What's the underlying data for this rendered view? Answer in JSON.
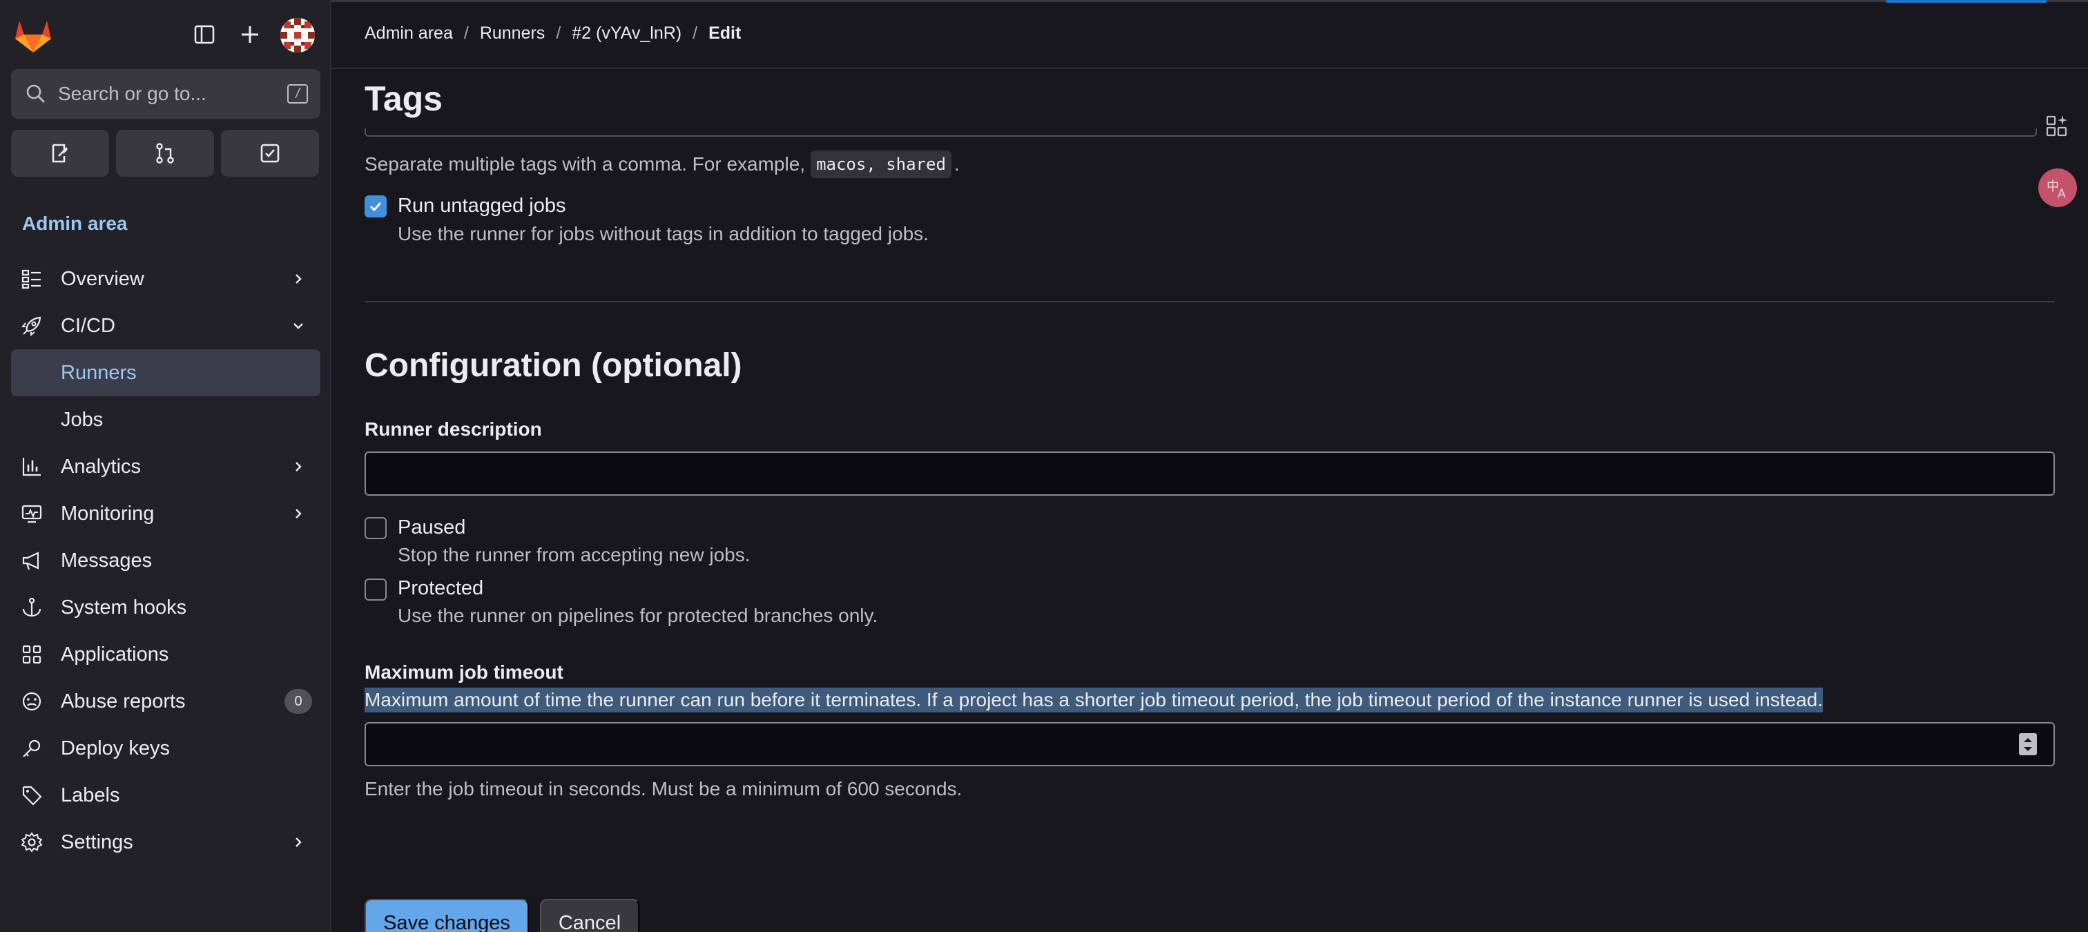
{
  "sidebar": {
    "search_placeholder": "Search or go to...",
    "search_shortcut": "/",
    "section_title": "Admin area",
    "items": [
      {
        "label": "Overview",
        "icon": "overview-icon",
        "chevron": "right"
      },
      {
        "label": "CI/CD",
        "icon": "rocket-icon",
        "chevron": "down"
      },
      {
        "label": "Runners",
        "sub": true,
        "active": true
      },
      {
        "label": "Jobs",
        "sub": true
      },
      {
        "label": "Analytics",
        "icon": "chart-icon",
        "chevron": "right"
      },
      {
        "label": "Monitoring",
        "icon": "monitor-icon",
        "chevron": "right"
      },
      {
        "label": "Messages",
        "icon": "megaphone-icon"
      },
      {
        "label": "System hooks",
        "icon": "anchor-icon"
      },
      {
        "label": "Applications",
        "icon": "applications-icon"
      },
      {
        "label": "Abuse reports",
        "icon": "abuse-icon",
        "badge": "0"
      },
      {
        "label": "Deploy keys",
        "icon": "key-icon"
      },
      {
        "label": "Labels",
        "icon": "label-icon"
      },
      {
        "label": "Settings",
        "icon": "settings-icon",
        "chevron": "right"
      }
    ]
  },
  "breadcrumb": {
    "items": [
      "Admin area",
      "Runners",
      "#2 (vYAv_lnR)"
    ],
    "current": "Edit",
    "separator": "/"
  },
  "tags": {
    "heading": "Tags",
    "help_prefix": "Separate multiple tags with a comma. For example,",
    "help_code": "macos, shared",
    "help_suffix": ".",
    "run_untagged_label": "Run untagged jobs",
    "run_untagged_checked": true,
    "run_untagged_help": "Use the runner for jobs without tags in addition to tagged jobs."
  },
  "config": {
    "heading": "Configuration (optional)",
    "description_label": "Runner description",
    "description_value": "",
    "paused_label": "Paused",
    "paused_checked": false,
    "paused_help": "Stop the runner from accepting new jobs.",
    "protected_label": "Protected",
    "protected_checked": false,
    "protected_help": "Use the runner on pipelines for protected branches only.",
    "timeout_label": "Maximum job timeout",
    "timeout_description": "Maximum amount of time the runner can run before it terminates. If a project has a shorter job timeout period, the job timeout period of the instance runner is used instead.",
    "timeout_value": "",
    "timeout_help": "Enter the job timeout in seconds. Must be a minimum of 600 seconds."
  },
  "actions": {
    "save_label": "Save changes",
    "cancel_label": "Cancel"
  },
  "colors": {
    "accent": "#9dc7f1",
    "primary_button": "#63a6e9",
    "checkbox_on": "#428fdc",
    "selection": "#3e5a7c"
  }
}
